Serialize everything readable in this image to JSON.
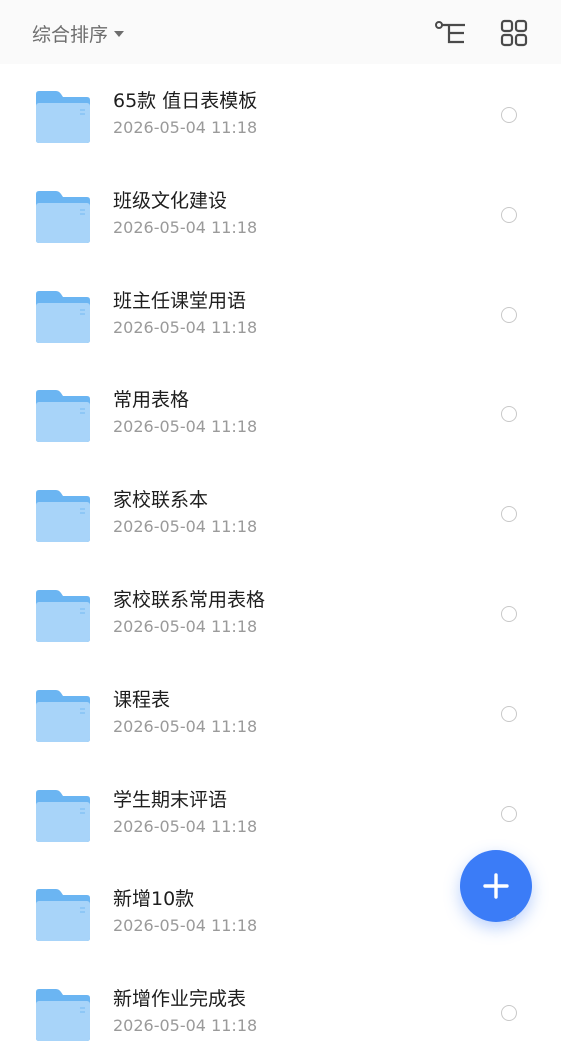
{
  "header": {
    "sort_label": "综合排序",
    "icons": {
      "sort_caret": "caret-down-icon",
      "tree": "tree-view-icon",
      "grid": "grid-view-icon"
    }
  },
  "files": [
    {
      "name": "65款 值日表模板",
      "date": "2026-05-04 11:18"
    },
    {
      "name": "班级文化建设",
      "date": "2026-05-04 11:18"
    },
    {
      "name": "班主任课堂用语",
      "date": "2026-05-04 11:18"
    },
    {
      "name": "常用表格",
      "date": "2026-05-04 11:18"
    },
    {
      "name": "家校联系本",
      "date": "2026-05-04 11:18"
    },
    {
      "name": "家校联系常用表格",
      "date": "2026-05-04 11:18"
    },
    {
      "name": "课程表",
      "date": "2026-05-04 11:18"
    },
    {
      "name": "学生期末评语",
      "date": "2026-05-04 11:18"
    },
    {
      "name": "新增10款",
      "date": "2026-05-04 11:18"
    },
    {
      "name": "新增作业完成表",
      "date": "2026-05-04 11:18"
    }
  ],
  "fab": {
    "icon": "plus-icon",
    "color": "#3b7cf7"
  },
  "colors": {
    "folder_light": "#9fd0f8",
    "folder_dark": "#62b0f0",
    "text": "#1e1e1e",
    "subtext": "#9a9a9a"
  }
}
